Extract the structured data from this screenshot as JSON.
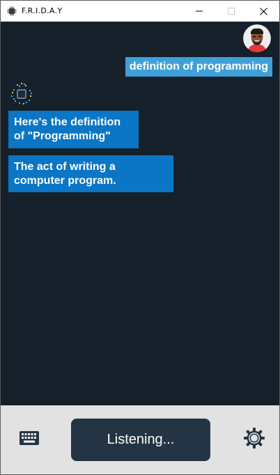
{
  "window": {
    "title": "F.R.I.D.A.Y"
  },
  "chat": {
    "messages": [
      {
        "role": "user",
        "text": "definition of programming"
      },
      {
        "role": "assistant",
        "text": "Here's the definition of \"Programming\""
      },
      {
        "role": "assistant",
        "text": "The act of writing a computer program."
      }
    ]
  },
  "bottom": {
    "status_label": "Listening...",
    "icons": [
      "keyboard-icon",
      "gear-icon"
    ]
  },
  "colors": {
    "chat_background": "#16202b",
    "user_bubble": "#3fa0d8",
    "assistant_bubble": "#0a76c5",
    "bottom_bar": "#e2e2e2",
    "listen_button": "#243444"
  }
}
